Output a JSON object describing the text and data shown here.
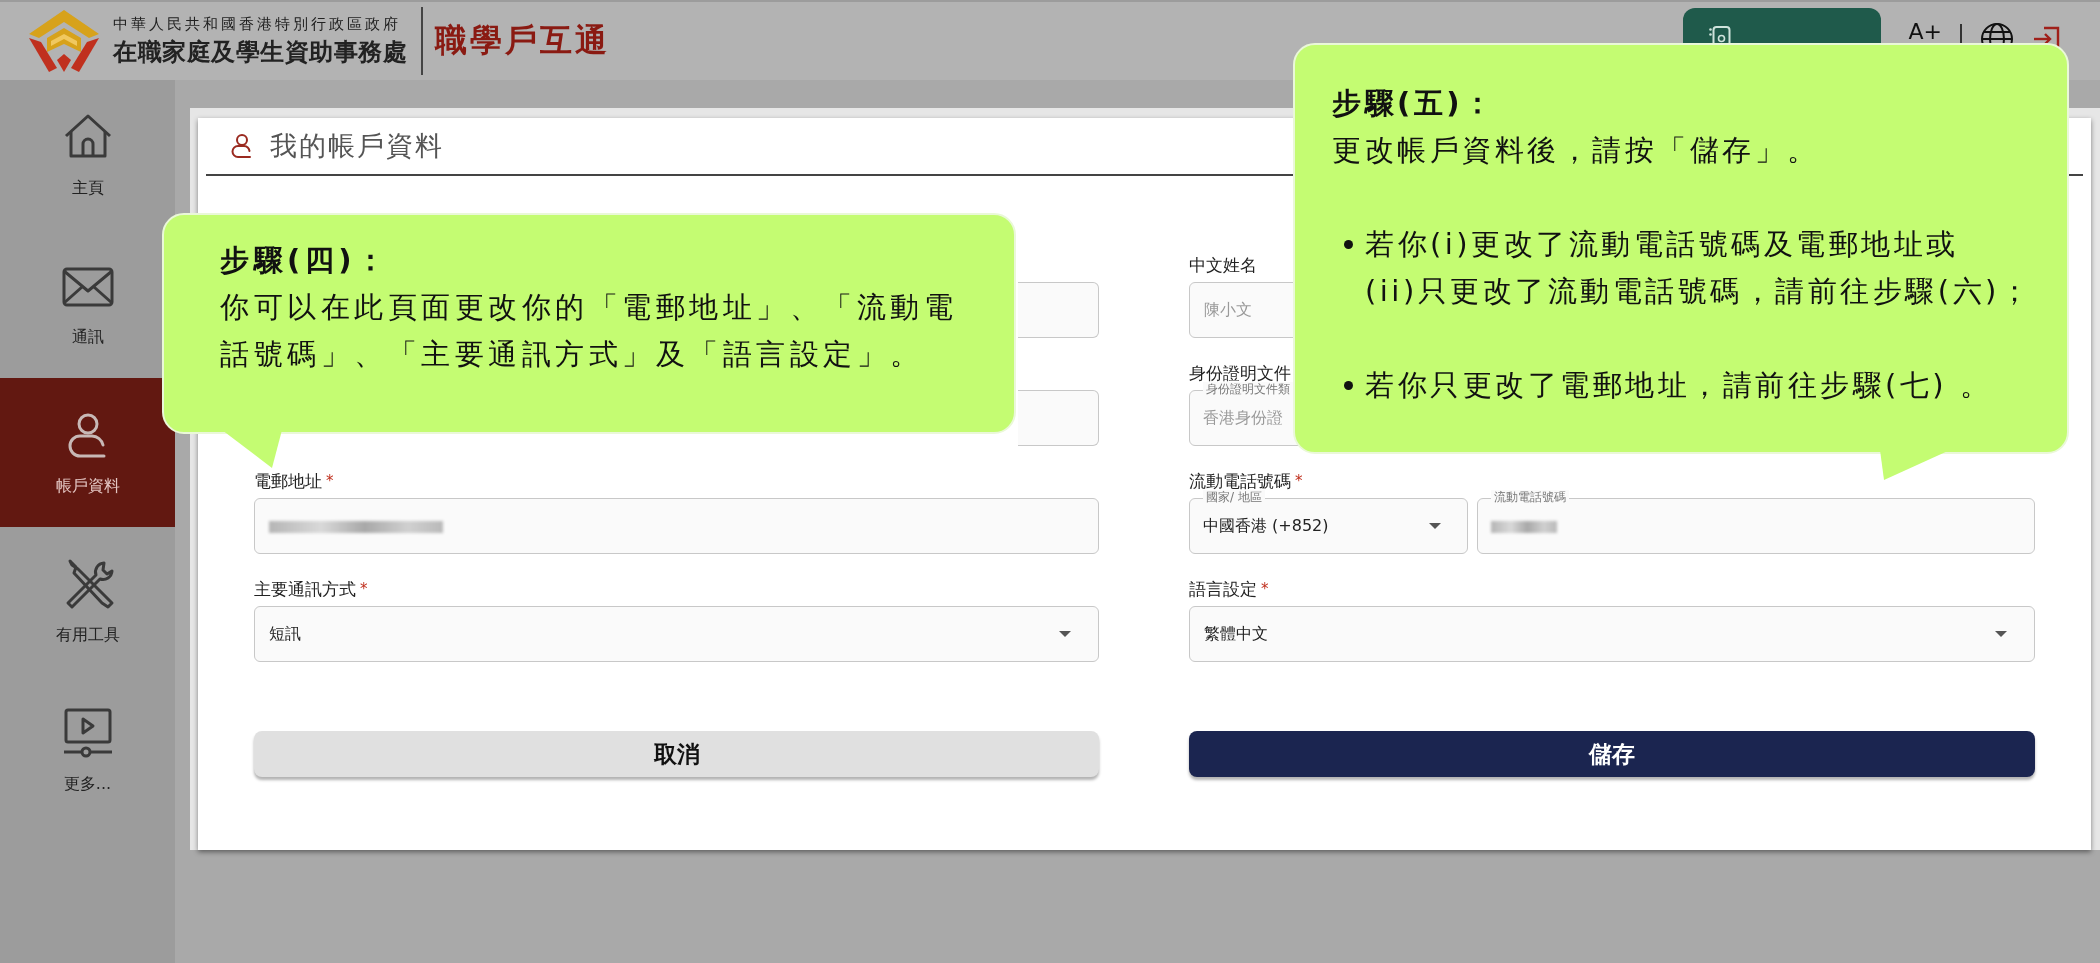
{
  "header": {
    "org_line1": "中華人民共和國香港特別行政區政府",
    "org_line2": "在職家庭及學生資助事務處",
    "app_name": "職學戶互通",
    "font_size_button": "A+"
  },
  "sidebar": {
    "items": [
      {
        "label": "主頁",
        "kind": "home",
        "selected": false
      },
      {
        "label": "通訊",
        "kind": "mail",
        "selected": false
      },
      {
        "label": "帳戶資料",
        "kind": "person",
        "selected": true
      },
      {
        "label": "有用工具",
        "kind": "tools",
        "selected": false
      },
      {
        "label": "更多...",
        "kind": "video",
        "selected": false
      }
    ]
  },
  "page": {
    "title": "我的帳戶資料"
  },
  "form": {
    "left": [
      {
        "kind": "covered"
      },
      {
        "kind": "covered"
      },
      {
        "kind": "text",
        "label": "電郵地址",
        "mark": "*",
        "redacted": true
      },
      {
        "kind": "select",
        "label": "主要通訊方式",
        "mark": "*",
        "value": "短訊"
      }
    ],
    "right": [
      {
        "kind": "text",
        "label": "中文姓名",
        "value": "陳小文",
        "disabled": true
      },
      {
        "kind": "text",
        "label": "身份證明文件",
        "float_label": "身份證明文件類",
        "value": "香港身份證",
        "disabled": true
      },
      {
        "kind": "phone",
        "label": "流動電話號碼",
        "mark": "*",
        "country_label": "國家/ 地區",
        "country_value": "中國香港 (+852)",
        "number_label": "流動電話號碼",
        "redacted": true
      },
      {
        "kind": "select",
        "label": "語言設定",
        "mark": "*",
        "value": "繁體中文"
      }
    ]
  },
  "buttons": [
    {
      "label": "取消",
      "kind": "secondary"
    },
    {
      "label": "儲存",
      "kind": "primary"
    }
  ],
  "callouts": [
    {
      "kind": "left",
      "title": "步驟(四)：",
      "body_lines": [
        "你可以在此頁面更改你的「電郵地址」、「流動電",
        "話號碼」、「主要通訊方式」及「語言設定」。"
      ]
    },
    {
      "kind": "right",
      "title": "步驟(五)：",
      "body_lines": [
        "更改帳戶資料後，請按「儲存」。"
      ],
      "bullets": [
        {
          "lines": [
            "若你(i)更改了流動電話號碼及電郵地址或",
            "(ii)只更改了流動電話號碼，請前往步驟(六)；"
          ]
        },
        {
          "lines": [
            "若你只更改了電郵地址，請前往步驟(七) 。"
          ]
        }
      ]
    }
  ]
}
